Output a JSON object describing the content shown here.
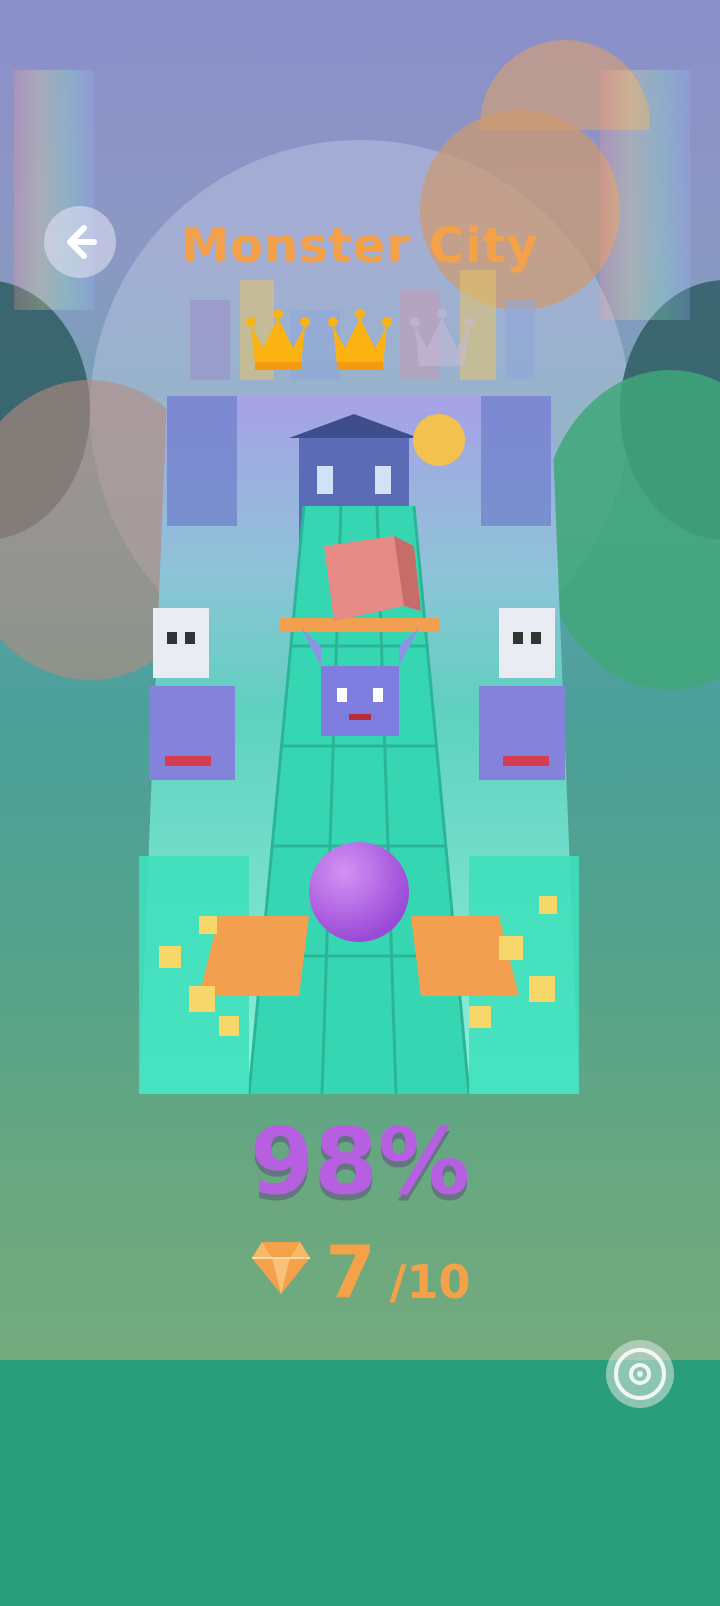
{
  "level": {
    "title": "Monster City",
    "crowns_earned": 2,
    "crowns_total": 3
  },
  "progress": {
    "percent_label": "98%",
    "percent_value": 98
  },
  "gems": {
    "collected": "7",
    "total": "/10"
  },
  "icons": {
    "back": "back-arrow-icon",
    "crown": "crown-icon",
    "gem": "diamond-icon",
    "music": "music-disc-icon"
  },
  "colors": {
    "title": "#f5a14a",
    "percent": "#b65fe0",
    "crown_gold": "#fbb314",
    "ball": "#b366e8",
    "tile": "#2fd3b0"
  }
}
